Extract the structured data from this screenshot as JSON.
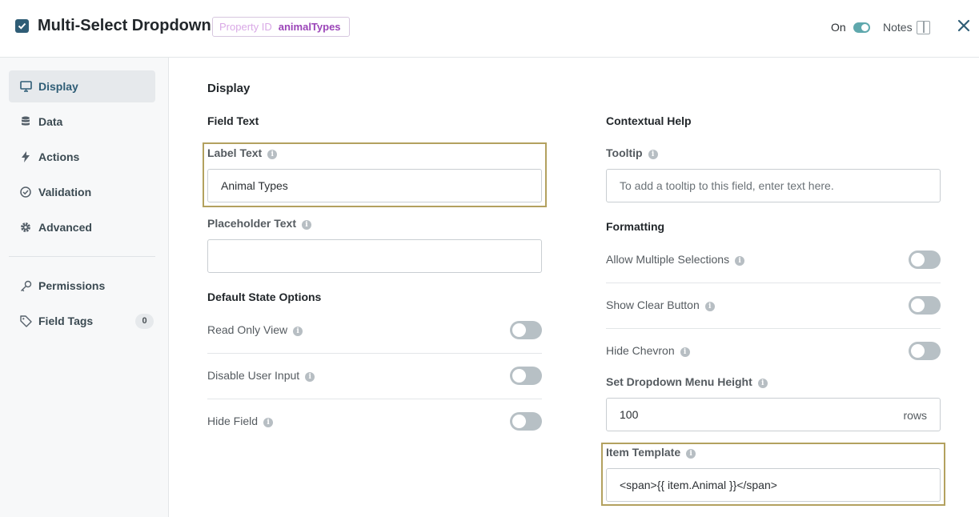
{
  "header": {
    "title": "Multi-Select Dropdown",
    "property_id_label": "Property ID",
    "property_id_value": "animalTypes",
    "on_label": "On",
    "on_state": true,
    "notes_label": "Notes",
    "accent_color": "#5fa8ad"
  },
  "sidebar": {
    "items": [
      {
        "label": "Display",
        "icon": "monitor-icon",
        "active": true
      },
      {
        "label": "Data",
        "icon": "database-icon"
      },
      {
        "label": "Actions",
        "icon": "lightning-icon"
      },
      {
        "label": "Validation",
        "icon": "check-circle-icon"
      },
      {
        "label": "Advanced",
        "icon": "gear-icon"
      },
      {
        "label": "Permissions",
        "icon": "key-icon"
      },
      {
        "label": "Field Tags",
        "icon": "tag-icon",
        "badge": "0"
      }
    ]
  },
  "main": {
    "section_title": "Display",
    "left": {
      "field_text_title": "Field Text",
      "label_text": {
        "label": "Label Text",
        "value": "Animal Types"
      },
      "placeholder_text": {
        "label": "Placeholder Text",
        "value": ""
      },
      "default_state_title": "Default State Options",
      "toggles": [
        {
          "label": "Read Only View",
          "on": false
        },
        {
          "label": "Disable User Input",
          "on": false
        },
        {
          "label": "Hide Field",
          "on": false
        }
      ]
    },
    "right": {
      "contextual_help_title": "Contextual Help",
      "tooltip": {
        "label": "Tooltip",
        "placeholder": "To add a tooltip to this field, enter text here."
      },
      "formatting_title": "Formatting",
      "toggles": [
        {
          "label": "Allow Multiple Selections",
          "on": false
        },
        {
          "label": "Show Clear Button",
          "on": false
        },
        {
          "label": "Hide Chevron",
          "on": false
        }
      ],
      "menu_height": {
        "label": "Set Dropdown Menu Height",
        "value": "100",
        "suffix": "rows"
      },
      "item_template": {
        "label": "Item Template",
        "value": "<span>{{ item.Animal }}</span>"
      }
    }
  }
}
